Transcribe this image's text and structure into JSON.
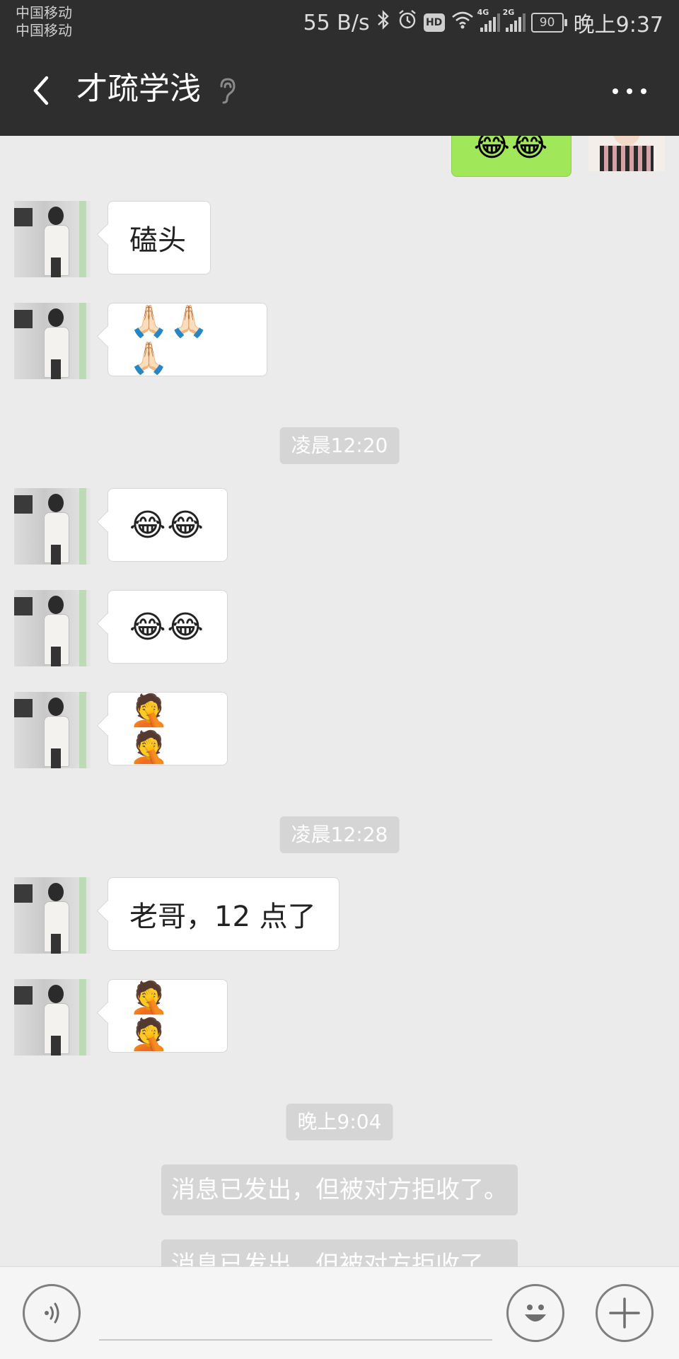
{
  "status_bar": {
    "carrier_1": "中国移动",
    "carrier_2": "中国移动",
    "net_speed": "55 B/s",
    "hd_label": "HD",
    "net_4g": "4G",
    "net_2g": "2G",
    "battery": "90",
    "time": "晚上9:37"
  },
  "header": {
    "title": "才疏学浅",
    "back_icon": "chevron-left-icon",
    "ear_icon": "ear-icon",
    "more_icon": "more-horizontal-icon"
  },
  "top_partial_message": {
    "text": "😂😂"
  },
  "messages": [
    {
      "text": "磕头"
    },
    {
      "text": "🙏🏻🙏🏻🙏🏻"
    },
    {
      "text": "😂😂"
    },
    {
      "text": "😂😂"
    },
    {
      "text": "🤦🤦"
    },
    {
      "text": "老哥，12 点了"
    },
    {
      "text": "🤦🤦"
    }
  ],
  "timestamps": [
    "凌晨12:20",
    "凌晨12:28",
    "晚上9:04"
  ],
  "system_notices": [
    "消息已发出，但被对方拒收了。",
    "消息已发出，但被对方拒收了。"
  ],
  "input_bar": {
    "voice_icon": "voice-icon",
    "emoji_icon": "emoji-icon",
    "plus_icon": "plus-icon",
    "input_value": ""
  },
  "colors": {
    "header_bg": "#2e2e2e",
    "chat_bg": "#ebebeb",
    "my_bubble": "#a0e75a",
    "timestamp_bg": "#d5d5d5"
  }
}
